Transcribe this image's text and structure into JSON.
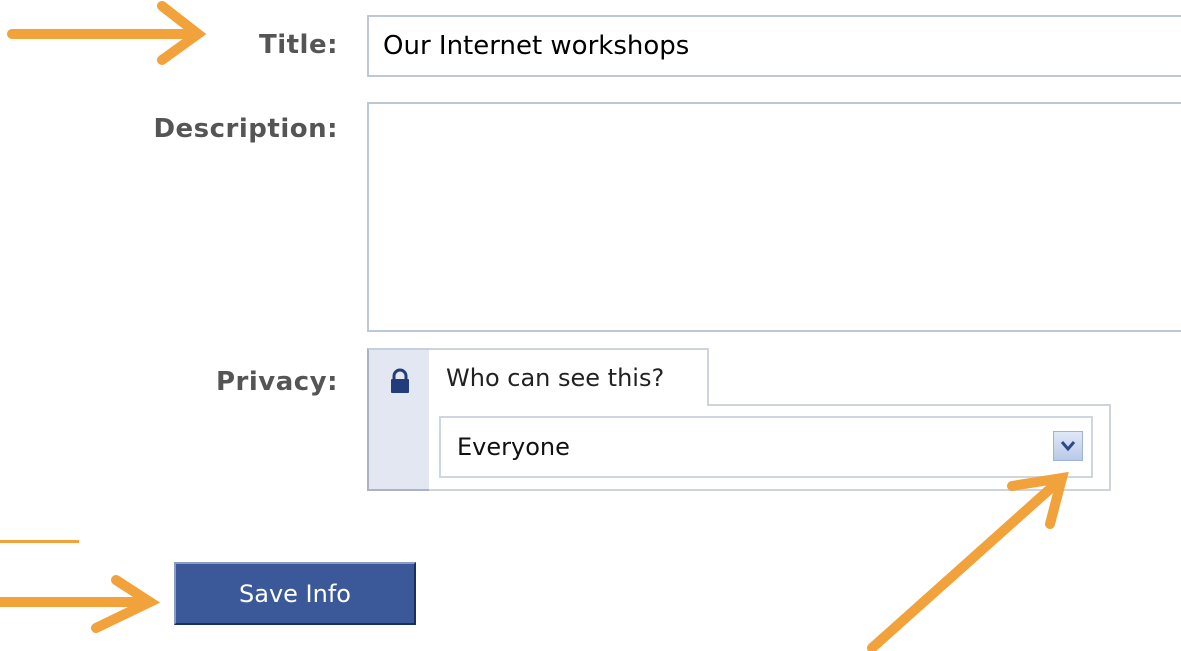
{
  "form": {
    "title_label": "Title:",
    "title_value": "Our Internet workshops",
    "description_label": "Description:",
    "description_value": "",
    "privacy_label": "Privacy:",
    "privacy_question": "Who can see this?",
    "privacy_selected": "Everyone",
    "save_label": "Save Info"
  },
  "icons": {
    "lock": "lock-icon",
    "dropdown": "chevron-down-icon"
  },
  "colors": {
    "button_bg": "#3b5998",
    "annotation_arrow": "#f2a23a",
    "label_text": "#555555",
    "input_border": "#bdc7d8"
  }
}
